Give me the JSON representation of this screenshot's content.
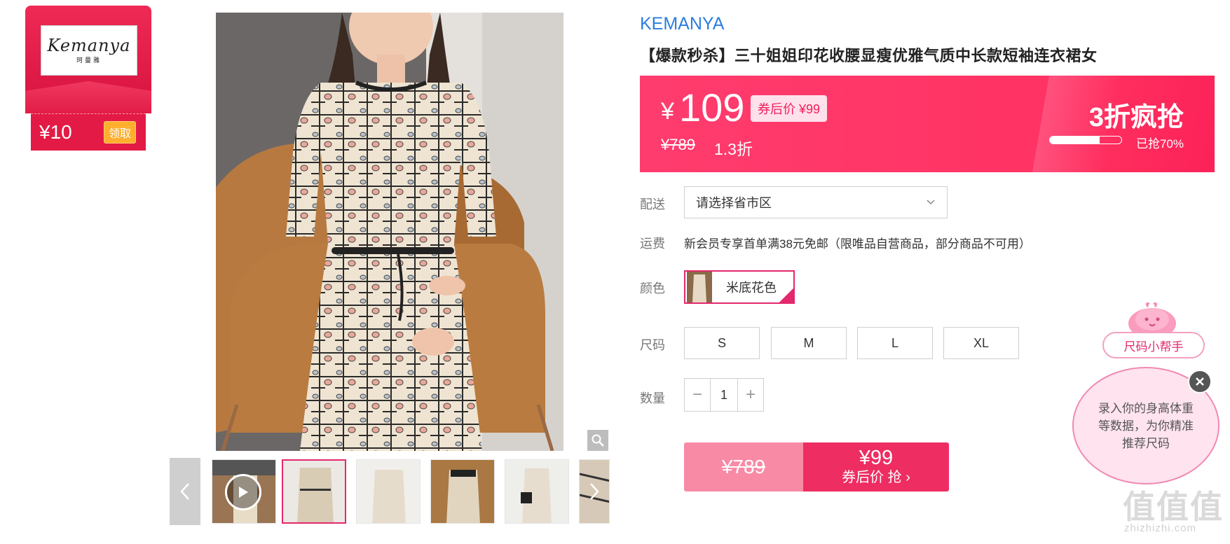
{
  "coupon": {
    "logo_main": "Kemanya",
    "logo_sub": "珂曼雅",
    "amount": "¥10",
    "claim_label": "领取"
  },
  "product": {
    "brand": "KEMANYA",
    "title": "【爆款秒杀】三十姐姐印花收腰显瘦优雅气质中长款短袖连衣裙女"
  },
  "price": {
    "currency": "¥",
    "current": "109",
    "after_coupon": "券后价 ¥99",
    "original": "¥789",
    "discount": "1.3折",
    "promo_title": "3折疯抢",
    "progress_percent": 70,
    "progress_text": "已抢70%"
  },
  "delivery": {
    "label": "配送",
    "placeholder": "请选择省市区"
  },
  "shipping": {
    "label": "运费",
    "text": "新会员专享首单满38元免邮（限唯品自营商品，部分商品不可用）"
  },
  "color": {
    "label": "颜色",
    "option": "米底花色"
  },
  "size": {
    "label": "尺码",
    "options": [
      "S",
      "M",
      "L",
      "XL"
    ]
  },
  "quantity": {
    "label": "数量",
    "minus": "−",
    "value": "1",
    "plus": "+"
  },
  "buy_button": {
    "original": "¥789",
    "price": "¥99",
    "cta": "券后价 抢 ›"
  },
  "size_helper": {
    "label": "尺码小帮手",
    "text": "录入你的身高体重等数据，为你精准推荐尺码"
  },
  "watermark": {
    "main": "值值值",
    "sub": "zhizhizhi.com"
  },
  "colors": {
    "accent": "#ee2d62",
    "brand_link": "#2b7de0",
    "coupon_red": "#e31a45"
  }
}
